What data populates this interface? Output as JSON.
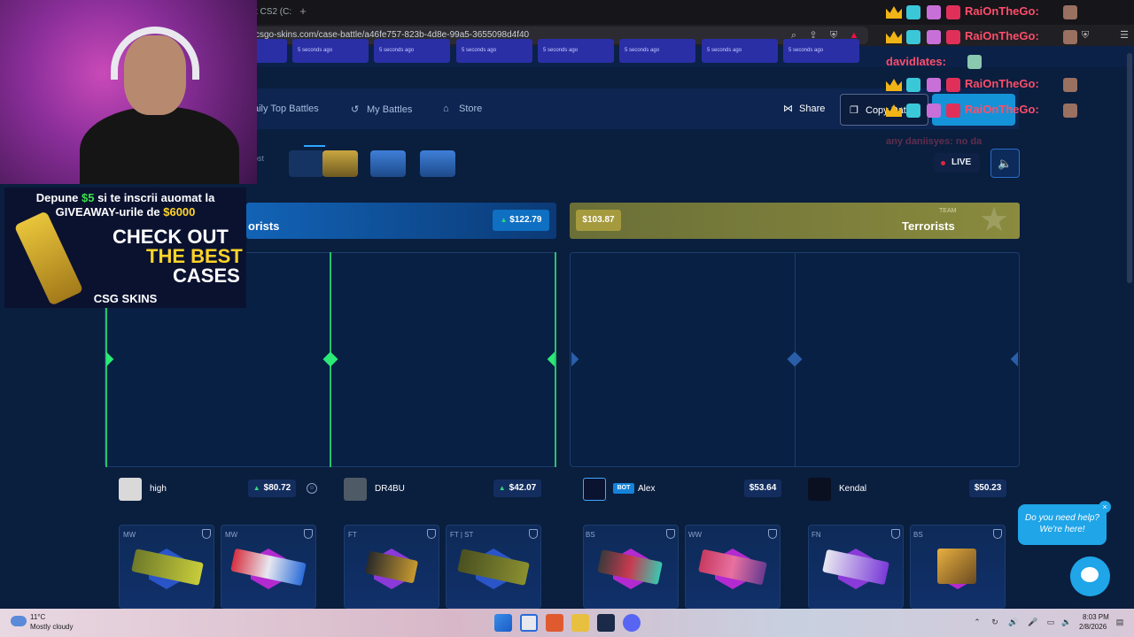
{
  "browser": {
    "tab_title": "t CS2 (C:",
    "new_tab": "+",
    "url": "csgo-skins.com/case-battle/a46fe757-823b-4d8e-99a5-3655098d4f40"
  },
  "recent_battles": [
    {
      "time": "5 seconds ago"
    },
    {
      "time": "5 seconds ago"
    },
    {
      "time": "5 seconds ago"
    },
    {
      "time": "5 seconds ago"
    },
    {
      "time": "5 seconds ago"
    },
    {
      "time": "5 seconds ago"
    },
    {
      "time": "5 seconds ago"
    }
  ],
  "nav": {
    "daily_top": "aily Top Battles",
    "my_battles": "My Battles",
    "store": "Store",
    "share": "Share",
    "copy": "Copy Dat"
  },
  "cases_row": {
    "label": "ost",
    "live": "LIVE"
  },
  "teams": {
    "ct": {
      "label": "orists",
      "value": "$122.79"
    },
    "t": {
      "team_label": "TEAM",
      "name": "Terrorists",
      "value": "$103.87"
    }
  },
  "players": [
    {
      "name": "high",
      "value": "$80.72"
    },
    {
      "name": "DR4BU",
      "value": "$42.07"
    },
    {
      "name": "Alex",
      "value": "$53.64",
      "badge": "BOT"
    },
    {
      "name": "Kendal",
      "value": "$50.23"
    }
  ],
  "items": [
    {
      "wear": "MW"
    },
    {
      "wear": "MW"
    },
    {
      "wear": "FT"
    },
    {
      "wear": "FT | ST"
    },
    {
      "wear": "BS"
    },
    {
      "wear": "WW"
    },
    {
      "wear": "FN"
    },
    {
      "wear": "BS"
    }
  ],
  "overlay": {
    "ad_top_1a": "Depune ",
    "ad_top_1b": "$5",
    "ad_top_1c": " si te inscrii auomat la",
    "ad_top_2a": "GIVEAWAY-urile de ",
    "ad_top_2b": "$6000",
    "ad_check": "CHECK OUT",
    "ad_best": "THE BEST",
    "ad_cases": "CASES",
    "ad_logo": "CSG SKINS",
    "chat_name": "RaiOnTheGo:",
    "chat_user2": "davidlates:",
    "chat_faded": "any daniisyes: no da"
  },
  "help": {
    "bubble": "Do you need help? We're here!",
    "close": "×"
  },
  "taskbar": {
    "temp": "11°C",
    "weather": "Mostly cloudy",
    "time": "8:03 PM",
    "date": "2/8/2026"
  },
  "colors": {
    "accent": "#1593d8",
    "ct": "#1263b6",
    "t": "#8a8b3e",
    "green": "#25c36a",
    "chat": "#ff4d6a"
  }
}
